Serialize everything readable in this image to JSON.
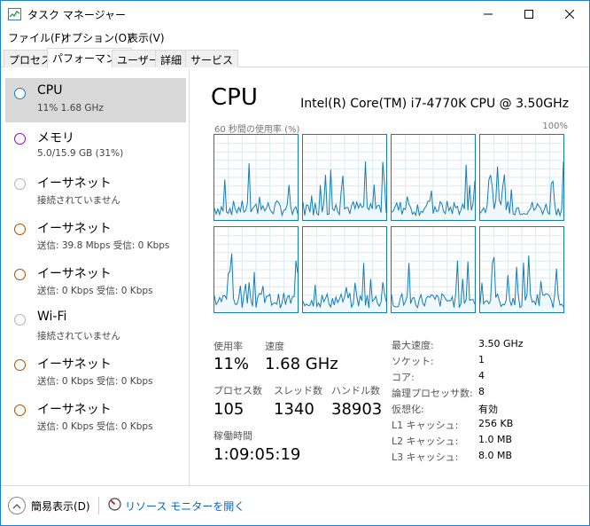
{
  "window": {
    "title": "タスク マネージャー",
    "accent": "#1883d7"
  },
  "menu": [
    {
      "label": "ファイル(F)"
    },
    {
      "label": "オプション(O)"
    },
    {
      "label": "表示(V)"
    }
  ],
  "tabs": [
    {
      "label": "プロセス",
      "active": false
    },
    {
      "label": "パフォーマンス",
      "active": true
    },
    {
      "label": "ユーザー",
      "active": false
    },
    {
      "label": "詳細",
      "active": false
    },
    {
      "label": "サービス",
      "active": false
    }
  ],
  "sidebar": {
    "items": [
      {
        "title": "CPU",
        "sub": "11%  1.68 GHz",
        "color": "#117dbb",
        "selected": true
      },
      {
        "title": "メモリ",
        "sub": "5.0/15.9 GB (31%)",
        "color": "#8b12ae",
        "selected": false
      },
      {
        "title": "イーサネット",
        "sub": "接続されていません",
        "color": "#b3b3b3",
        "selected": false
      },
      {
        "title": "イーサネット",
        "sub": "送信: 39.8 Mbps 受信: 0 Kbps",
        "color": "#a74f01",
        "selected": false
      },
      {
        "title": "イーサネット",
        "sub": "送信: 0 Kbps 受信: 0 Kbps",
        "color": "#a74f01",
        "selected": false
      },
      {
        "title": "Wi-Fi",
        "sub": "接続されていません",
        "color": "#b3b3b3",
        "selected": false
      },
      {
        "title": "イーサネット",
        "sub": "送信: 0 Kbps 受信: 0 Kbps",
        "color": "#a74f01",
        "selected": false
      },
      {
        "title": "イーサネット",
        "sub": "送信: 0 Kbps 受信: 0 Kbps",
        "color": "#a74f01",
        "selected": false
      }
    ]
  },
  "main": {
    "title": "CPU",
    "model": "Intel(R) Core(TM) i7-4770K CPU @ 3.50GHz",
    "graph_label_left": "60 秒間の使用率 (%)",
    "graph_label_right": "100%",
    "graph_color": "#117dbb",
    "graph_count": 8,
    "stats": {
      "usage_label": "使用率",
      "usage_value": "11%",
      "speed_label": "速度",
      "speed_value": "1.68 GHz",
      "processes_label": "プロセス数",
      "processes_value": "105",
      "threads_label": "スレッド数",
      "threads_value": "1340",
      "handles_label": "ハンドル数",
      "handles_value": "38903",
      "uptime_label": "稼働時間",
      "uptime_value": "1:09:05:19"
    },
    "details": [
      {
        "key": "最大速度:",
        "value": "3.50 GHz"
      },
      {
        "key": "ソケット:",
        "value": "1"
      },
      {
        "key": "コア:",
        "value": "4"
      },
      {
        "key": "論理プロセッサ数:",
        "value": "8"
      },
      {
        "key": "仮想化:",
        "value": "有効"
      },
      {
        "key": "L1 キャッシュ:",
        "value": "256 KB"
      },
      {
        "key": "L2 キャッシュ:",
        "value": "1.0 MB"
      },
      {
        "key": "L3 キャッシュ:",
        "value": "8.0 MB"
      }
    ]
  },
  "footer": {
    "fewer_details": "簡易表示(D)",
    "resource_monitor": "リソース モニターを開く",
    "link_color": "#0066cc"
  }
}
